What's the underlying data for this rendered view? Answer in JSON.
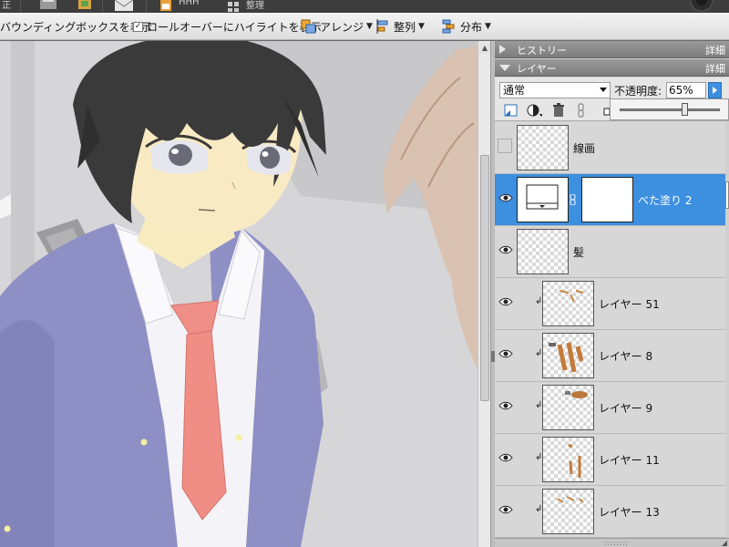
{
  "topbar": {
    "left_text": "正",
    "mid_text": "HHH",
    "right_text": "整理"
  },
  "options_bar": {
    "bounding_box_label": "バウンディングボックスを表示",
    "rollover_label": "ロールオーバーにハイライトを表示",
    "rollover_checked": true,
    "arrange_label": "アレンジ",
    "align_label": "整列",
    "distribute_label": "分布"
  },
  "panels": {
    "history": {
      "title": "ヒストリー",
      "more": "詳細"
    },
    "layers": {
      "title": "レイヤー",
      "more": "詳細"
    }
  },
  "layer_options": {
    "blend_mode": "通常",
    "opacity_label": "不透明度:",
    "opacity_value": "65%",
    "opacity_fraction": 0.65
  },
  "layers": [
    {
      "name": "線画",
      "visible": false,
      "selected": false,
      "clipped": false,
      "type": "raster"
    },
    {
      "name": "べた塗り 2",
      "visible": true,
      "selected": true,
      "clipped": false,
      "type": "fill"
    },
    {
      "name": "髪",
      "visible": true,
      "selected": false,
      "clipped": false,
      "type": "raster"
    },
    {
      "name": "レイヤー 51",
      "visible": true,
      "selected": false,
      "clipped": true,
      "type": "raster"
    },
    {
      "name": "レイヤー 8",
      "visible": true,
      "selected": false,
      "clipped": true,
      "type": "raster"
    },
    {
      "name": "レイヤー 9",
      "visible": true,
      "selected": false,
      "clipped": true,
      "type": "raster"
    },
    {
      "name": "レイヤー 11",
      "visible": true,
      "selected": false,
      "clipped": true,
      "type": "raster"
    },
    {
      "name": "レイヤー 13",
      "visible": true,
      "selected": false,
      "clipped": true,
      "type": "raster"
    }
  ],
  "colors": {
    "selection": "#3d8fe0",
    "panel_header": "#8a8a8a",
    "jacket": "#8e8fc4",
    "tie": "#f0908a",
    "hair": "#3a3a3a"
  }
}
